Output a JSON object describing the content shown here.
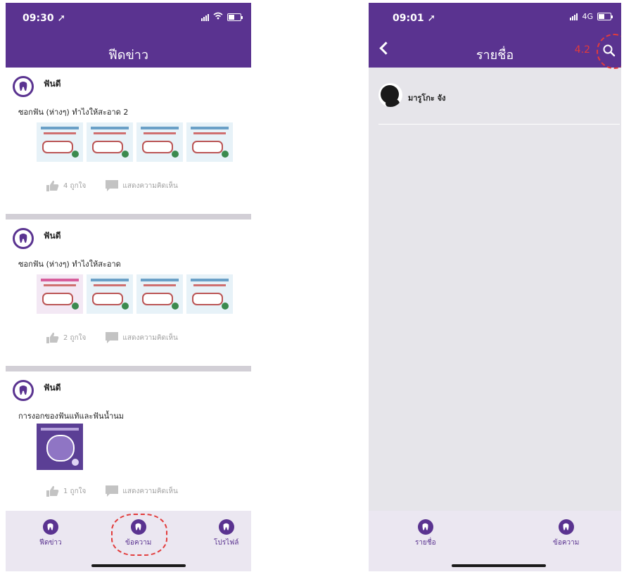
{
  "left": {
    "status_time": "09:30",
    "nav_title": "ฟีดข่าว",
    "posts": [
      {
        "author": "ฟันดี",
        "text": "ซอกฟัน (ห่างๆ) ทำไงให้สะอาด 2",
        "likes": "4 ถูกใจ",
        "comment": "แสดงความคิดเห็น"
      },
      {
        "author": "ฟันดี",
        "text": "ซอกฟัน (ห่างๆ) ทำไงให้สะอาด",
        "likes": "2 ถูกใจ",
        "comment": "แสดงความคิดเห็น"
      },
      {
        "author": "ฟันดี",
        "text": "การงอกของฟันแท้และฟันน้ำนม",
        "likes": "1 ถูกใจ",
        "comment": "แสดงความคิดเห็น"
      }
    ],
    "tabs": [
      "ฟีดข่าว",
      "ข้อความ",
      "โปรไฟล์"
    ]
  },
  "right": {
    "status_time": "09:01",
    "network": "4G",
    "nav_title": "รายชื่อ",
    "annotation": "4.2",
    "contact_name": "มารูโกะ จัง",
    "tabs": [
      "รายชื่อ",
      "ข้อความ"
    ]
  },
  "colors": {
    "brand": "#5a3390",
    "annotation": "#e23b3b",
    "tabbar": "#ebe7f1"
  }
}
